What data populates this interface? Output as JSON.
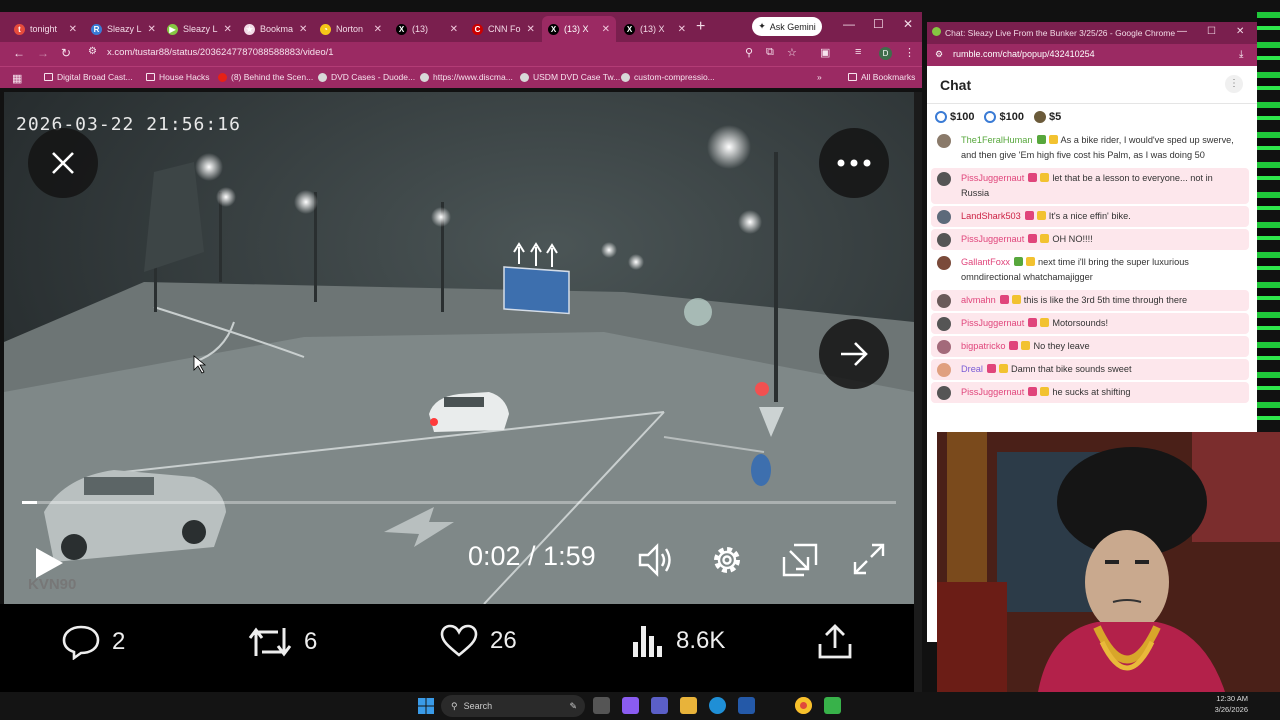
{
  "browser": {
    "tabs": [
      {
        "label": "tonight",
        "color": "#e74c3c",
        "glyph": "t"
      },
      {
        "label": "Sleazy L",
        "color": "#3a7bd5",
        "glyph": "R"
      },
      {
        "label": "Sleazy L",
        "color": "#85c742",
        "glyph": "▶"
      },
      {
        "label": "Bookma",
        "color": "#f3dbe7",
        "glyph": "★"
      },
      {
        "label": "Norton",
        "color": "#f5c518",
        "glyph": "◔"
      },
      {
        "label": "(13)",
        "color": "#000000",
        "glyph": "X"
      },
      {
        "label": "CNN Fo",
        "color": "#cc0000",
        "glyph": "C"
      },
      {
        "label": "(13) X",
        "color": "#000000",
        "glyph": "X"
      },
      {
        "label": "(13) X",
        "color": "#000000",
        "glyph": "X"
      }
    ],
    "ask_gemini": "Ask Gemini",
    "url": "x.com/tustar88/status/2036247787088588883/video/1",
    "profile_initial": "D",
    "bookmarks": [
      {
        "label": "Digital Broad Cast...",
        "kind": "folder"
      },
      {
        "label": "House Hacks",
        "kind": "folder"
      },
      {
        "label": "(8) Behind the Scen...",
        "kind": "youtube"
      },
      {
        "label": "DVD Cases - Duode...",
        "kind": "site"
      },
      {
        "label": "https://www.discma...",
        "kind": "site"
      },
      {
        "label": "USDM DVD Case Tw...",
        "kind": "site"
      },
      {
        "label": "custom-compressio...",
        "kind": "site"
      }
    ],
    "all_bookmarks": "All Bookmarks"
  },
  "video": {
    "timestamp": "2026-03-22 21:56:16",
    "watermark": "KVN90",
    "time_display": "0:02 / 1:59",
    "progress": 0.017
  },
  "post_actions": {
    "replies": "2",
    "reposts": "6",
    "likes": "26",
    "views": "8.6K"
  },
  "chat_window": {
    "title": "Chat: Sleazy Live From the Bunker 3/25/26 - Google Chrome",
    "url": "rumble.com/chat/popup/432410254",
    "header": "Chat",
    "tips": [
      "$100",
      "$100",
      "$5"
    ],
    "messages": [
      {
        "user": "The1FeralHuman",
        "color": "#57a73c",
        "text": "As a bike rider, I would've sped up swerve, and then give 'Em high five cost his Palm, as I was doing 50",
        "pink": false
      },
      {
        "user": "PissJuggernaut",
        "color": "#e0457b",
        "text": "let that be a lesson to everyone... not in Russia",
        "pink": true
      },
      {
        "user": "LandShark503",
        "color": "#cc2244",
        "text": "It's a nice effin' bike.",
        "pink": true
      },
      {
        "user": "PissJuggernaut",
        "color": "#e0457b",
        "text": "OH NO!!!!",
        "pink": true
      },
      {
        "user": "GallantFoxx",
        "color": "#e0457b",
        "text": "next time i'll bring the super luxurious omndirectional whatchamajigger",
        "pink": false
      },
      {
        "user": "alvmahn",
        "color": "#e0457b",
        "text": "this is like the 3rd 5th time through there",
        "pink": true
      },
      {
        "user": "PissJuggernaut",
        "color": "#e0457b",
        "text": "Motorsounds!",
        "pink": true
      },
      {
        "user": "bigpatricko",
        "color": "#e0457b",
        "text": "No they leave",
        "pink": true
      },
      {
        "user": "Dreal",
        "color": "#7a5cd6",
        "text": "Damn that bike sounds sweet",
        "pink": true
      },
      {
        "user": "PissJuggernaut",
        "color": "#e0457b",
        "text": "he sucks at shifting",
        "pink": true
      }
    ]
  },
  "taskbar": {
    "search_placeholder": "Search",
    "time": "12:30 AM",
    "date": "3/26/2026"
  }
}
